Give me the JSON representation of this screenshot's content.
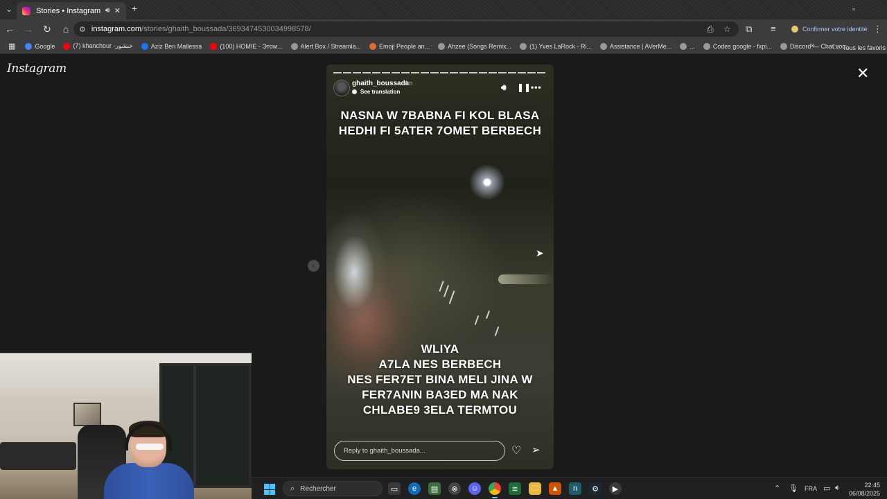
{
  "browser": {
    "tab_title": "Stories • Instagram",
    "url_host": "instagram.com",
    "url_path": "/stories/ghaith_boussada/3693474530034998578/",
    "profile_label": "Confirmer votre identité",
    "bookmarks": [
      {
        "label": "Google",
        "color": "#4285f4"
      },
      {
        "label": "(7) khanchour -خنشور",
        "color": "#ff0000"
      },
      {
        "label": "Aziz Ben Mallessa",
        "color": "#1877f2"
      },
      {
        "label": "(100) HOMIE - Этом...",
        "color": "#ff0000"
      },
      {
        "label": "Alert Box / Streamla...",
        "color": "#999999"
      },
      {
        "label": "Emoji People an...",
        "color": "#e06c2e"
      },
      {
        "label": "Ahzee (Songs Remix...",
        "color": "#999999"
      },
      {
        "label": "(1) Yves LaRock - Ri...",
        "color": "#999999"
      },
      {
        "label": "Assistance | AVerMe...",
        "color": "#999999"
      },
      {
        "label": "...",
        "color": "#999999"
      },
      {
        "label": "Codes google - fxpi...",
        "color": "#999999"
      },
      {
        "label": "Discord — Chat voc...",
        "color": "#999999"
      }
    ],
    "all_bookmarks_label": "Tous les favoris"
  },
  "instagram": {
    "logo": "Instagram",
    "story": {
      "author": "ghaith_boussada",
      "time": "4m",
      "see_translation": "See translation",
      "caption_top": "NASNA W 7BABNA FI KOL BLASA HEDHI FI 5ATER 7OMET BERBECH",
      "caption_bottom_lines": [
        "WLIYA",
        "A7LA NES BERBECH",
        "NES FER7ET BINA MELI JINA W",
        "FER7ANIN BA3ED MA NAK",
        "CHLABE9 3ELA TERMTOU"
      ],
      "reply_placeholder": "Reply to ghaith_boussada..."
    }
  },
  "taskbar": {
    "search_placeholder": "Rechercher",
    "language": "FRA",
    "time": "22:45",
    "date": "06/08/2025"
  },
  "icons": {
    "close": "close-icon",
    "mute": "speaker-icon",
    "pause": "pause-icon",
    "more": "more-icon",
    "like": "heart-icon",
    "send": "send-icon"
  }
}
